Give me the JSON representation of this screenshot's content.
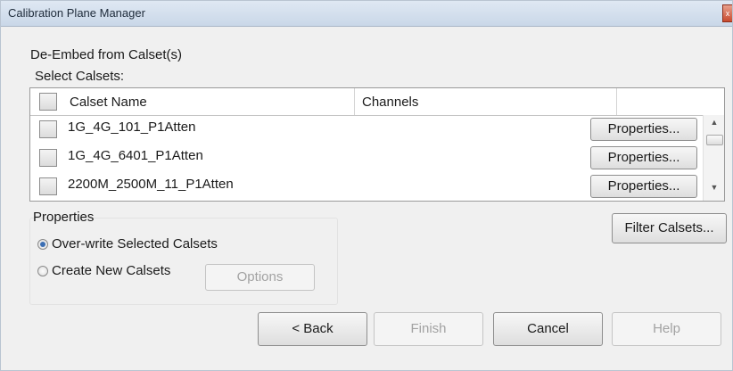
{
  "window": {
    "title": "Calibration Plane Manager",
    "close_glyph": "x"
  },
  "heading": "De-Embed from Calset(s)",
  "select_label": "Select Calsets:",
  "grid": {
    "columns": [
      "Calset Name",
      "Channels"
    ],
    "rows": [
      {
        "name": "1G_4G_101_P1Atten",
        "channels": "",
        "button": "Properties...",
        "checked": false
      },
      {
        "name": "1G_4G_6401_P1Atten",
        "channels": "",
        "button": "Properties...",
        "checked": false
      },
      {
        "name": "2200M_2500M_11_P1Atten",
        "channels": "",
        "button": "Properties...",
        "checked": false
      }
    ],
    "scroll_up_glyph": "▲",
    "scroll_down_glyph": "▼"
  },
  "filter_button": "Filter Calsets...",
  "properties": {
    "label": "Properties",
    "overwrite_label": "Over-write Selected Calsets",
    "overwrite_selected": true,
    "create_new_label": "Create New Calsets",
    "create_new_selected": false,
    "options_button": "Options"
  },
  "footer": {
    "back": "< Back",
    "finish": "Finish",
    "cancel": "Cancel",
    "help": "Help"
  },
  "colors": {
    "titlebar": "#c9d7e8",
    "dialog_bg": "#f0f0f0",
    "radio_dot": "#3c6fb4",
    "close": "#c84a2e"
  }
}
